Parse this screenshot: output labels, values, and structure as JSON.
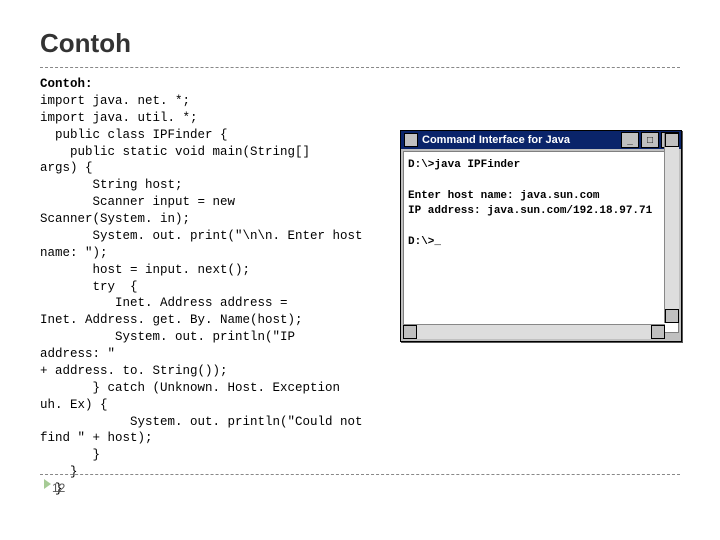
{
  "title": "Contoh",
  "code": {
    "l1": "Contoh:",
    "l2": "import java. net. *;",
    "l3": "import java. util. *;",
    "l4": "  public class IPFinder {",
    "l5": "    public static void main(String[]",
    "l6": "args) {",
    "l7": "       String host;",
    "l8": "       Scanner input = new",
    "l9": "Scanner(System. in);",
    "l10": "       System. out. print(\"\\n\\n. Enter host",
    "l11": "name: \");",
    "l12": "       host = input. next();",
    "l13": "       try  {",
    "l14": "          Inet. Address address =",
    "l15": "Inet. Address. get. By. Name(host);",
    "l16": "          System. out. println(\"IP",
    "l17": "address: \"",
    "l18": "+ address. to. String());",
    "l19": "       } catch (Unknown. Host. Exception",
    "l20": "uh. Ex) {",
    "l21": "            System. out. println(\"Could not",
    "l22": "find \" + host);",
    "l23": "       }",
    "l24": "    }",
    "l25": "  }"
  },
  "window": {
    "title": "Command Interface for Java",
    "btn_min": "_",
    "btn_max": "□",
    "btn_close": "×"
  },
  "console": {
    "l1": "D:\\>java IPFinder",
    "l2": "",
    "l3": "Enter host name: java.sun.com",
    "l4": "IP address: java.sun.com/192.18.97.71",
    "l5": "",
    "l6": "D:\\>_"
  },
  "pagenum": "12"
}
